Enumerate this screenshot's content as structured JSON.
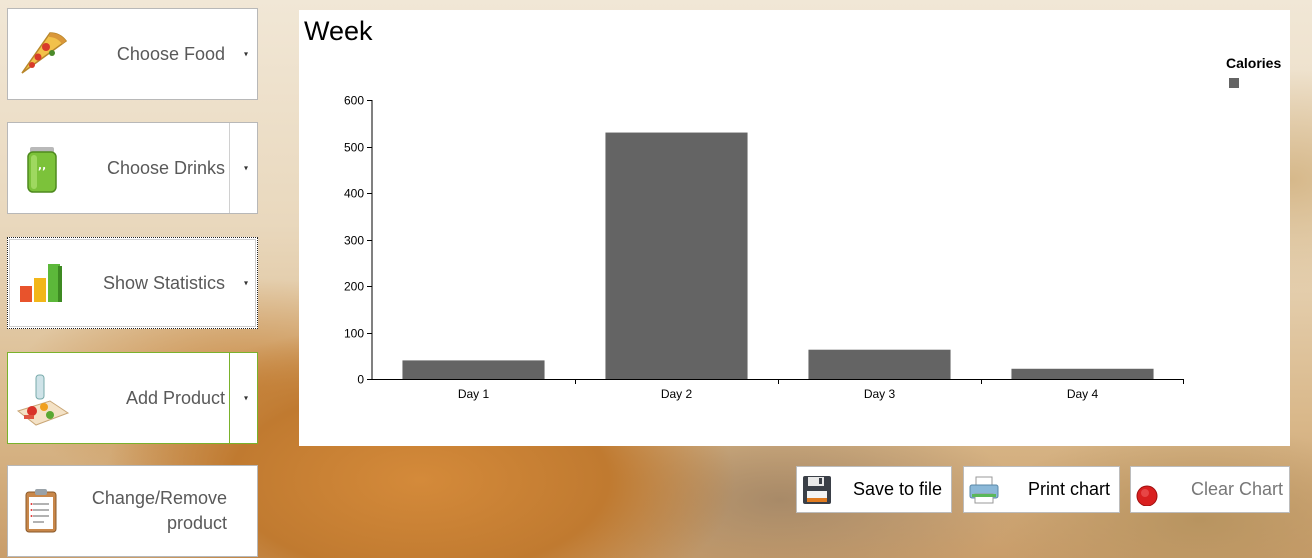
{
  "nav": {
    "food": {
      "label": "Choose Food",
      "icon": "pizza-icon"
    },
    "drinks": {
      "label": "Choose Drinks",
      "icon": "soda-can-icon"
    },
    "stats": {
      "label": "Show Statistics",
      "icon": "bar-chart-icon"
    },
    "add": {
      "label": "Add Product",
      "icon": "food-plate-icon"
    },
    "change": {
      "label_line1": "Change/Remove",
      "label_line2": "product",
      "icon": "clipboard-icon"
    },
    "dropdown_glyph": "▾"
  },
  "chart_panel": {
    "title": "Week",
    "legend": {
      "label": "Calories",
      "color": "#646464"
    }
  },
  "chart_data": {
    "type": "bar",
    "title": "Week",
    "categories": [
      "Day 1",
      "Day 2",
      "Day 3",
      "Day 4"
    ],
    "series": [
      {
        "name": "Calories",
        "values": [
          40,
          530,
          63,
          22
        ],
        "color": "#646464"
      }
    ],
    "ylim": [
      0,
      600
    ],
    "yticks": [
      0,
      100,
      200,
      300,
      400,
      500,
      600
    ],
    "grid": false,
    "legend_position": "top-right"
  },
  "actions": {
    "save": {
      "label": "Save to file",
      "icon": "floppy-disk-icon"
    },
    "print": {
      "label": "Print chart",
      "icon": "printer-icon"
    },
    "clear": {
      "label": "Clear Chart",
      "icon": "reset-icon"
    }
  }
}
